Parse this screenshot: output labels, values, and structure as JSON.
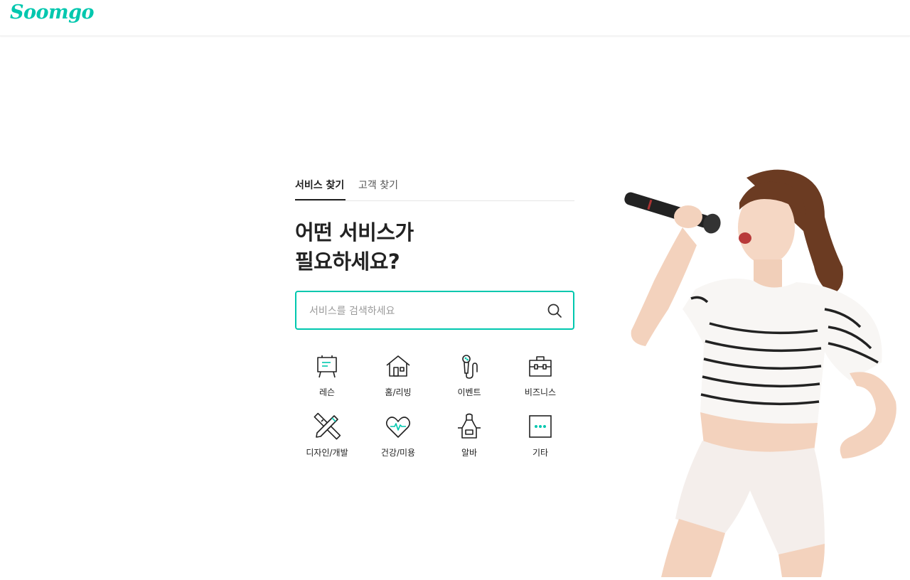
{
  "brand": {
    "logo_text": "Soomgo",
    "accent_color": "#00c7ae"
  },
  "tabs": [
    {
      "label": "서비스 찾기",
      "active": true
    },
    {
      "label": "고객 찾기",
      "active": false
    }
  ],
  "heading": {
    "line1": "어떤 서비스가",
    "line2": "필요하세요?"
  },
  "search": {
    "placeholder": "서비스를 검색하세요",
    "value": "",
    "icon": "search-icon"
  },
  "categories": [
    {
      "label": "레슨",
      "icon": "easel-icon"
    },
    {
      "label": "홈/리빙",
      "icon": "house-icon"
    },
    {
      "label": "이벤트",
      "icon": "microphone-icon"
    },
    {
      "label": "비즈니스",
      "icon": "briefcase-icon"
    },
    {
      "label": "디자인/개발",
      "icon": "pencil-ruler-icon"
    },
    {
      "label": "건강/미용",
      "icon": "heart-pulse-icon"
    },
    {
      "label": "알바",
      "icon": "apron-icon"
    },
    {
      "label": "기타",
      "icon": "more-dots-icon"
    }
  ],
  "hero": {
    "image": "woman-singing-with-microphone"
  }
}
